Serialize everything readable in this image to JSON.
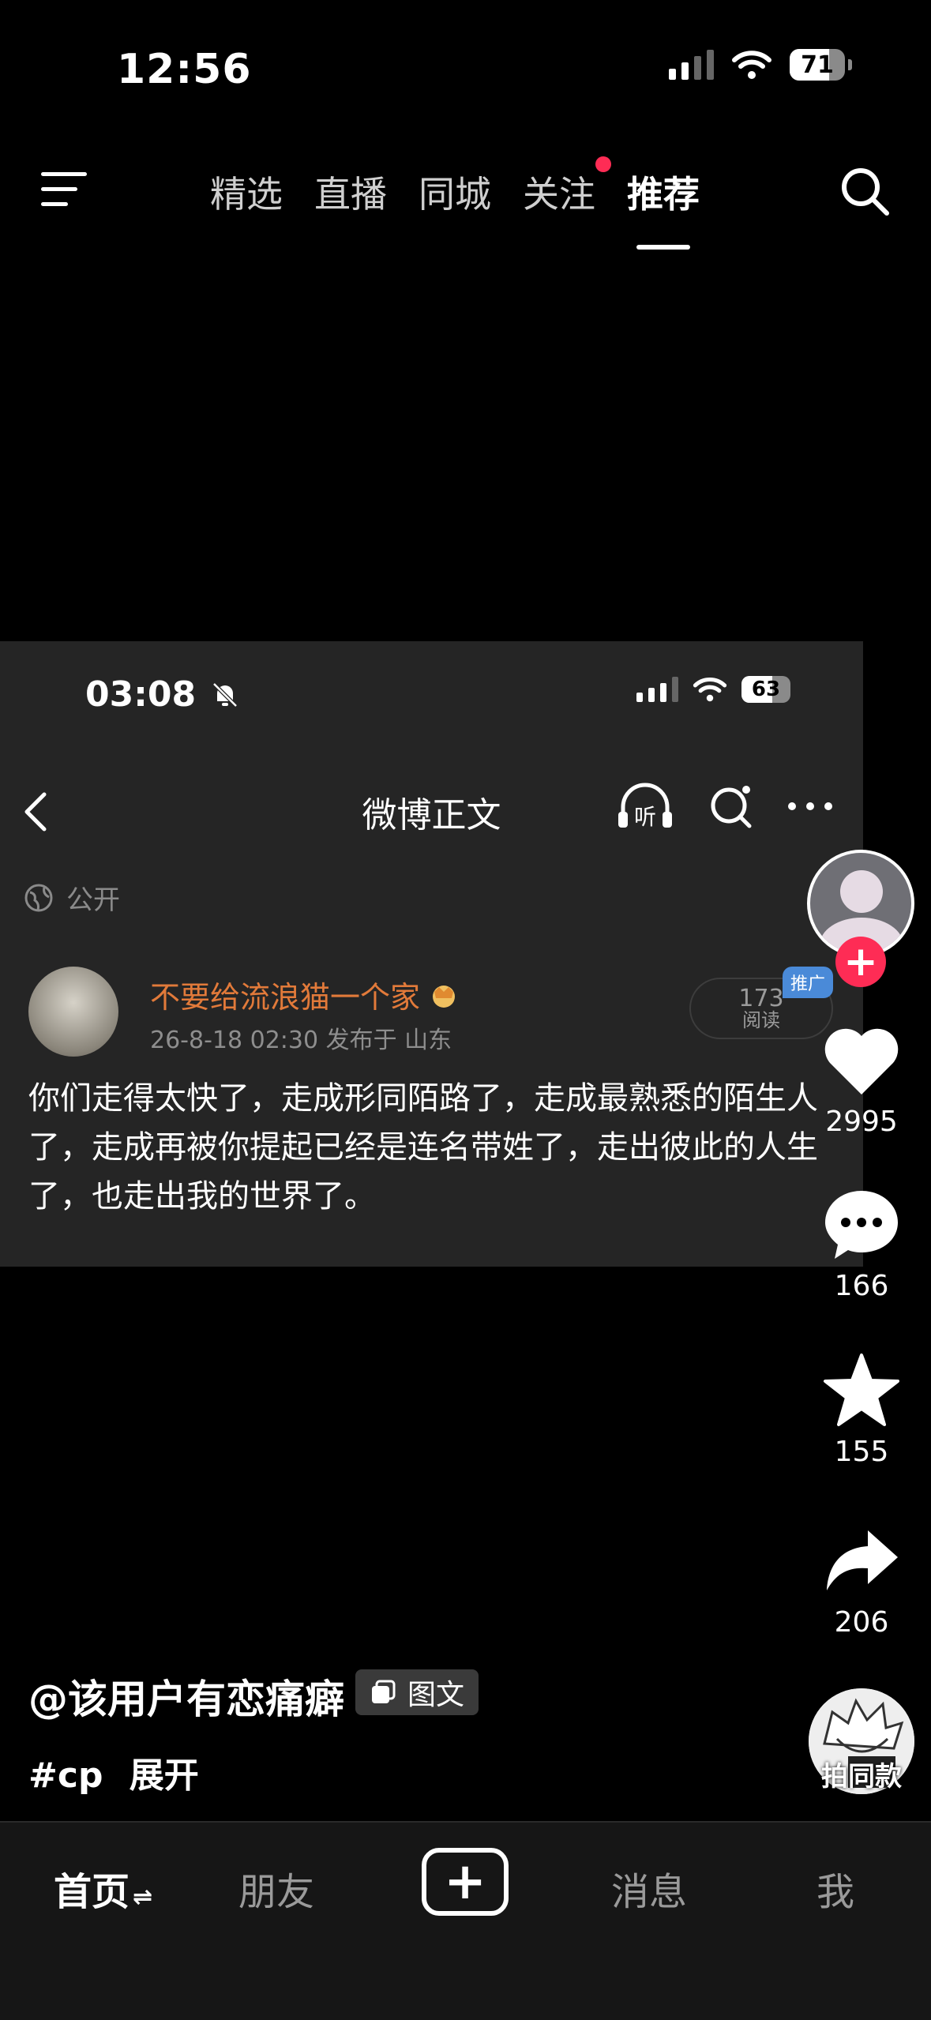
{
  "status_bar": {
    "time": "12:56",
    "battery": "71"
  },
  "top_nav": {
    "tabs": [
      {
        "label": "精选",
        "active": false
      },
      {
        "label": "直播",
        "active": false
      },
      {
        "label": "同城",
        "active": false
      },
      {
        "label": "关注",
        "active": false,
        "badge_dot": true
      },
      {
        "label": "推荐",
        "active": true
      }
    ]
  },
  "post_card": {
    "status_time": "03:08",
    "battery": "63",
    "title": "微博正文",
    "listen_label": "听",
    "visibility": "公开",
    "username": "不要给流浪猫一个家",
    "meta": "26-8-18 02:30  发布于 山东",
    "read_count": "173",
    "read_label": "阅读",
    "promo_label": "推广",
    "body": "你们走得太快了，走成形同陌路了，走成最熟悉的陌生人了，走成再被你提起已经是连名带姓了，走出彼此的人生了，也走出我的世界了。"
  },
  "actions": {
    "likes": "2995",
    "comments": "166",
    "favorites": "155",
    "shares": "206",
    "remix_label": "拍同款"
  },
  "caption": {
    "author": "@该用户有恋痛癖",
    "type_label": "图文",
    "hashtag": "#cp",
    "expand_label": "展开"
  },
  "tab_bar": {
    "home": "首页",
    "friends": "朋友",
    "messages": "消息",
    "me": "我"
  },
  "colors": {
    "accent": "#fe2c55",
    "username": "#e27a3a",
    "promo": "#4a8ad8"
  }
}
